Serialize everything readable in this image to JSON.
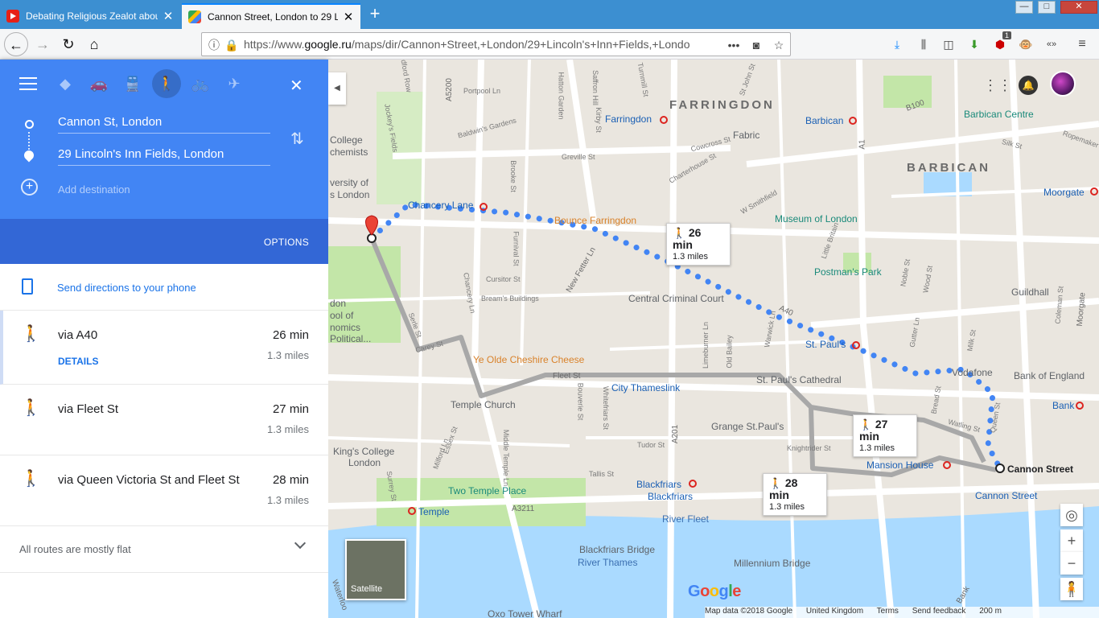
{
  "browser": {
    "tabs": [
      {
        "title": "Debating Religious Zealot abou",
        "favicon": "youtube-icon",
        "active": false
      },
      {
        "title": "Cannon Street, London to 29 Li",
        "favicon": "google-maps-icon",
        "active": true
      }
    ],
    "new_tab": "+",
    "url_prefix": "https://www.",
    "url_domain": "google.ru",
    "url_rest": "/maps/dir/Cannon+Street,+London/29+Lincoln's+Inn+Fields,+Londo",
    "page_actions": "•••",
    "addon_badge": "1",
    "window_controls": {
      "minimize": "—",
      "maximize": "□",
      "close": "✕"
    }
  },
  "directions": {
    "travel_modes": [
      {
        "name": "best",
        "icon": "best-route-icon",
        "glyph": "◆"
      },
      {
        "name": "driving",
        "icon": "car-icon",
        "glyph": "🚗"
      },
      {
        "name": "transit",
        "icon": "train-icon",
        "glyph": "🚆"
      },
      {
        "name": "walking",
        "icon": "walking-icon",
        "glyph": "🚶"
      },
      {
        "name": "cycling",
        "icon": "bicycle-icon",
        "glyph": "🚲"
      },
      {
        "name": "flights",
        "icon": "plane-icon",
        "glyph": "✈"
      }
    ],
    "origin": "Cannon St, London",
    "destination": "29 Lincoln's Inn Fields, London",
    "add_destination_placeholder": "Add destination",
    "options_label": "OPTIONS",
    "send_to_phone": "Send directions to your phone",
    "routes": [
      {
        "via": "via A40",
        "duration": "26 min",
        "distance": "1.3 miles",
        "details": "DETAILS"
      },
      {
        "via": "via Fleet St",
        "duration": "27 min",
        "distance": "1.3 miles"
      },
      {
        "via": "via Queen Victoria St and Fleet St",
        "duration": "28 min",
        "distance": "1.3 miles"
      }
    ],
    "terrain_note": "All routes are mostly flat"
  },
  "map": {
    "route_badges": [
      {
        "duration": "26 min",
        "distance": "1.3 miles"
      },
      {
        "duration": "27 min",
        "distance": "1.3 miles"
      },
      {
        "duration": "28 min",
        "distance": "1.3 miles"
      }
    ],
    "labels": {
      "farringdon_district": "FARRINGDON",
      "barbican_district": "BARBICAN",
      "farringdon_stn": "Farringdon",
      "barbican_stn": "Barbican",
      "barbican_centre": "Barbican Centre",
      "fabric": "Fabric",
      "moorgate": "Moorgate",
      "museum_of_london": "Museum of London",
      "postmans_park": "Postman's Park",
      "guildhall": "Guildhall",
      "central_criminal_court": "Central Criminal Court",
      "st_pauls": "St. Paul's",
      "st_pauls_cathedral": "St. Paul's Cathedral",
      "vodafone": "Vodafone",
      "bank_of_england": "Bank of England",
      "bank": "Bank",
      "chancery_lane": "Chancery Lane",
      "bounce_farringdon": "Bounce Farringdon",
      "ye_olde_cheshire": "Ye Olde Cheshire Cheese",
      "city_thameslink": "City Thameslink",
      "temple_church": "Temple Church",
      "grange_st_pauls": "Grange St.Paul's",
      "kings_college": "King's College",
      "kings_college_2": "London",
      "two_temple_place": "Two Temple Place",
      "temple": "Temple",
      "blackfriars_1": "Blackfriars",
      "blackfriars_2": "Blackfriars",
      "mansion_house": "Mansion House",
      "cannon_street_stn": "Cannon Street",
      "cannon_street": "Cannon Street",
      "river_fleet": "River Fleet",
      "blackfriars_bridge": "Blackfriars Bridge",
      "river_thames": "River Thames",
      "millennium_bridge": "Millennium Bridge",
      "oxo_tower": "Oxo Tower Wharf",
      "college": "College",
      "chemists": "chemists",
      "university_of": "versity of",
      "university_london": "s London",
      "lse_1": "don",
      "lse_2": "ool of",
      "lse_3": "nomics",
      "lse_4": "Political...",
      "fleet_st": "Fleet St",
      "new_fetter_ln": "New Fetter Ln",
      "a40": "A40",
      "a201": "A201",
      "a3211": "A3211",
      "a5200": "A5200",
      "a1": "A1",
      "b100": "B100",
      "waterloo": "Waterloo",
      "bank_road": "Bank"
    },
    "street_labels": {
      "hatton_garden": "Hatton Garden",
      "greville_st": "Greville St",
      "baldwins_gardens": "Baldwin's Gardens",
      "portpool_ln": "Portpool Ln",
      "saffron_hill": "Saffron Hill",
      "kirby_st": "Kirby St",
      "brooke_st": "Brooke St",
      "furnival_st": "Furnival St",
      "cursitor_st": "Cursitor St",
      "breams_buildings": "Bream's Buildings",
      "chancery_ln": "Chancery Ln",
      "carey_st": "Carey St",
      "serle_st": "Serle St",
      "bouverie_st": "Bouverie St",
      "whitefriars_st": "Whitefriars St",
      "middle_temple_ln": "Middle Temple Ln",
      "milford_ln": "Milford Ln",
      "surrey_st": "Surrey St",
      "tudor_st": "Tudor St",
      "tallis_st": "Tallis St",
      "old_bailey": "Old Bailey",
      "limeburner_ln": "Limeburner Ln",
      "warwick_ln": "Warwick Ln",
      "charterhouse_st": "Charterhouse St",
      "st_john_st": "St John St",
      "west_smithfield": "W Smithfield",
      "knightrider_st": "Knightrider St",
      "watling_st": "Watling St",
      "bread_st": "Bread St",
      "queen_st": "Queen St",
      "milk_st": "Milk St",
      "gutter_ln": "Gutter Ln",
      "wood_st": "Wood St",
      "silk_st": "Silk St",
      "ropemaker": "Ropemaker",
      "coleman_st": "Coleman St",
      "moorgate_road": "Moorgate",
      "noble_st": "Noble St",
      "essex_st": "Essex St",
      "little_britain": "Little Britain",
      "cowcross_st": "Cowcross St",
      "turnmill_st": "Turnmill St",
      "jockeys_fields": "Jockey's Fields",
      "bedford_row": "Bedford Row"
    },
    "satellite_label": "Satellite",
    "google_logo": "Google",
    "attribution": {
      "map_data": "Map data ©2018 Google",
      "region": "United Kingdom",
      "terms": "Terms",
      "feedback": "Send feedback",
      "scale": "200 m"
    },
    "zoom_in": "+",
    "zoom_out": "−",
    "colors": {
      "route_primary": "#4285f4",
      "route_alt": "#a8a8a8",
      "water": "#aadaff",
      "park": "#c3e6a8",
      "road": "#ffffff",
      "land": "#eae6df"
    }
  }
}
